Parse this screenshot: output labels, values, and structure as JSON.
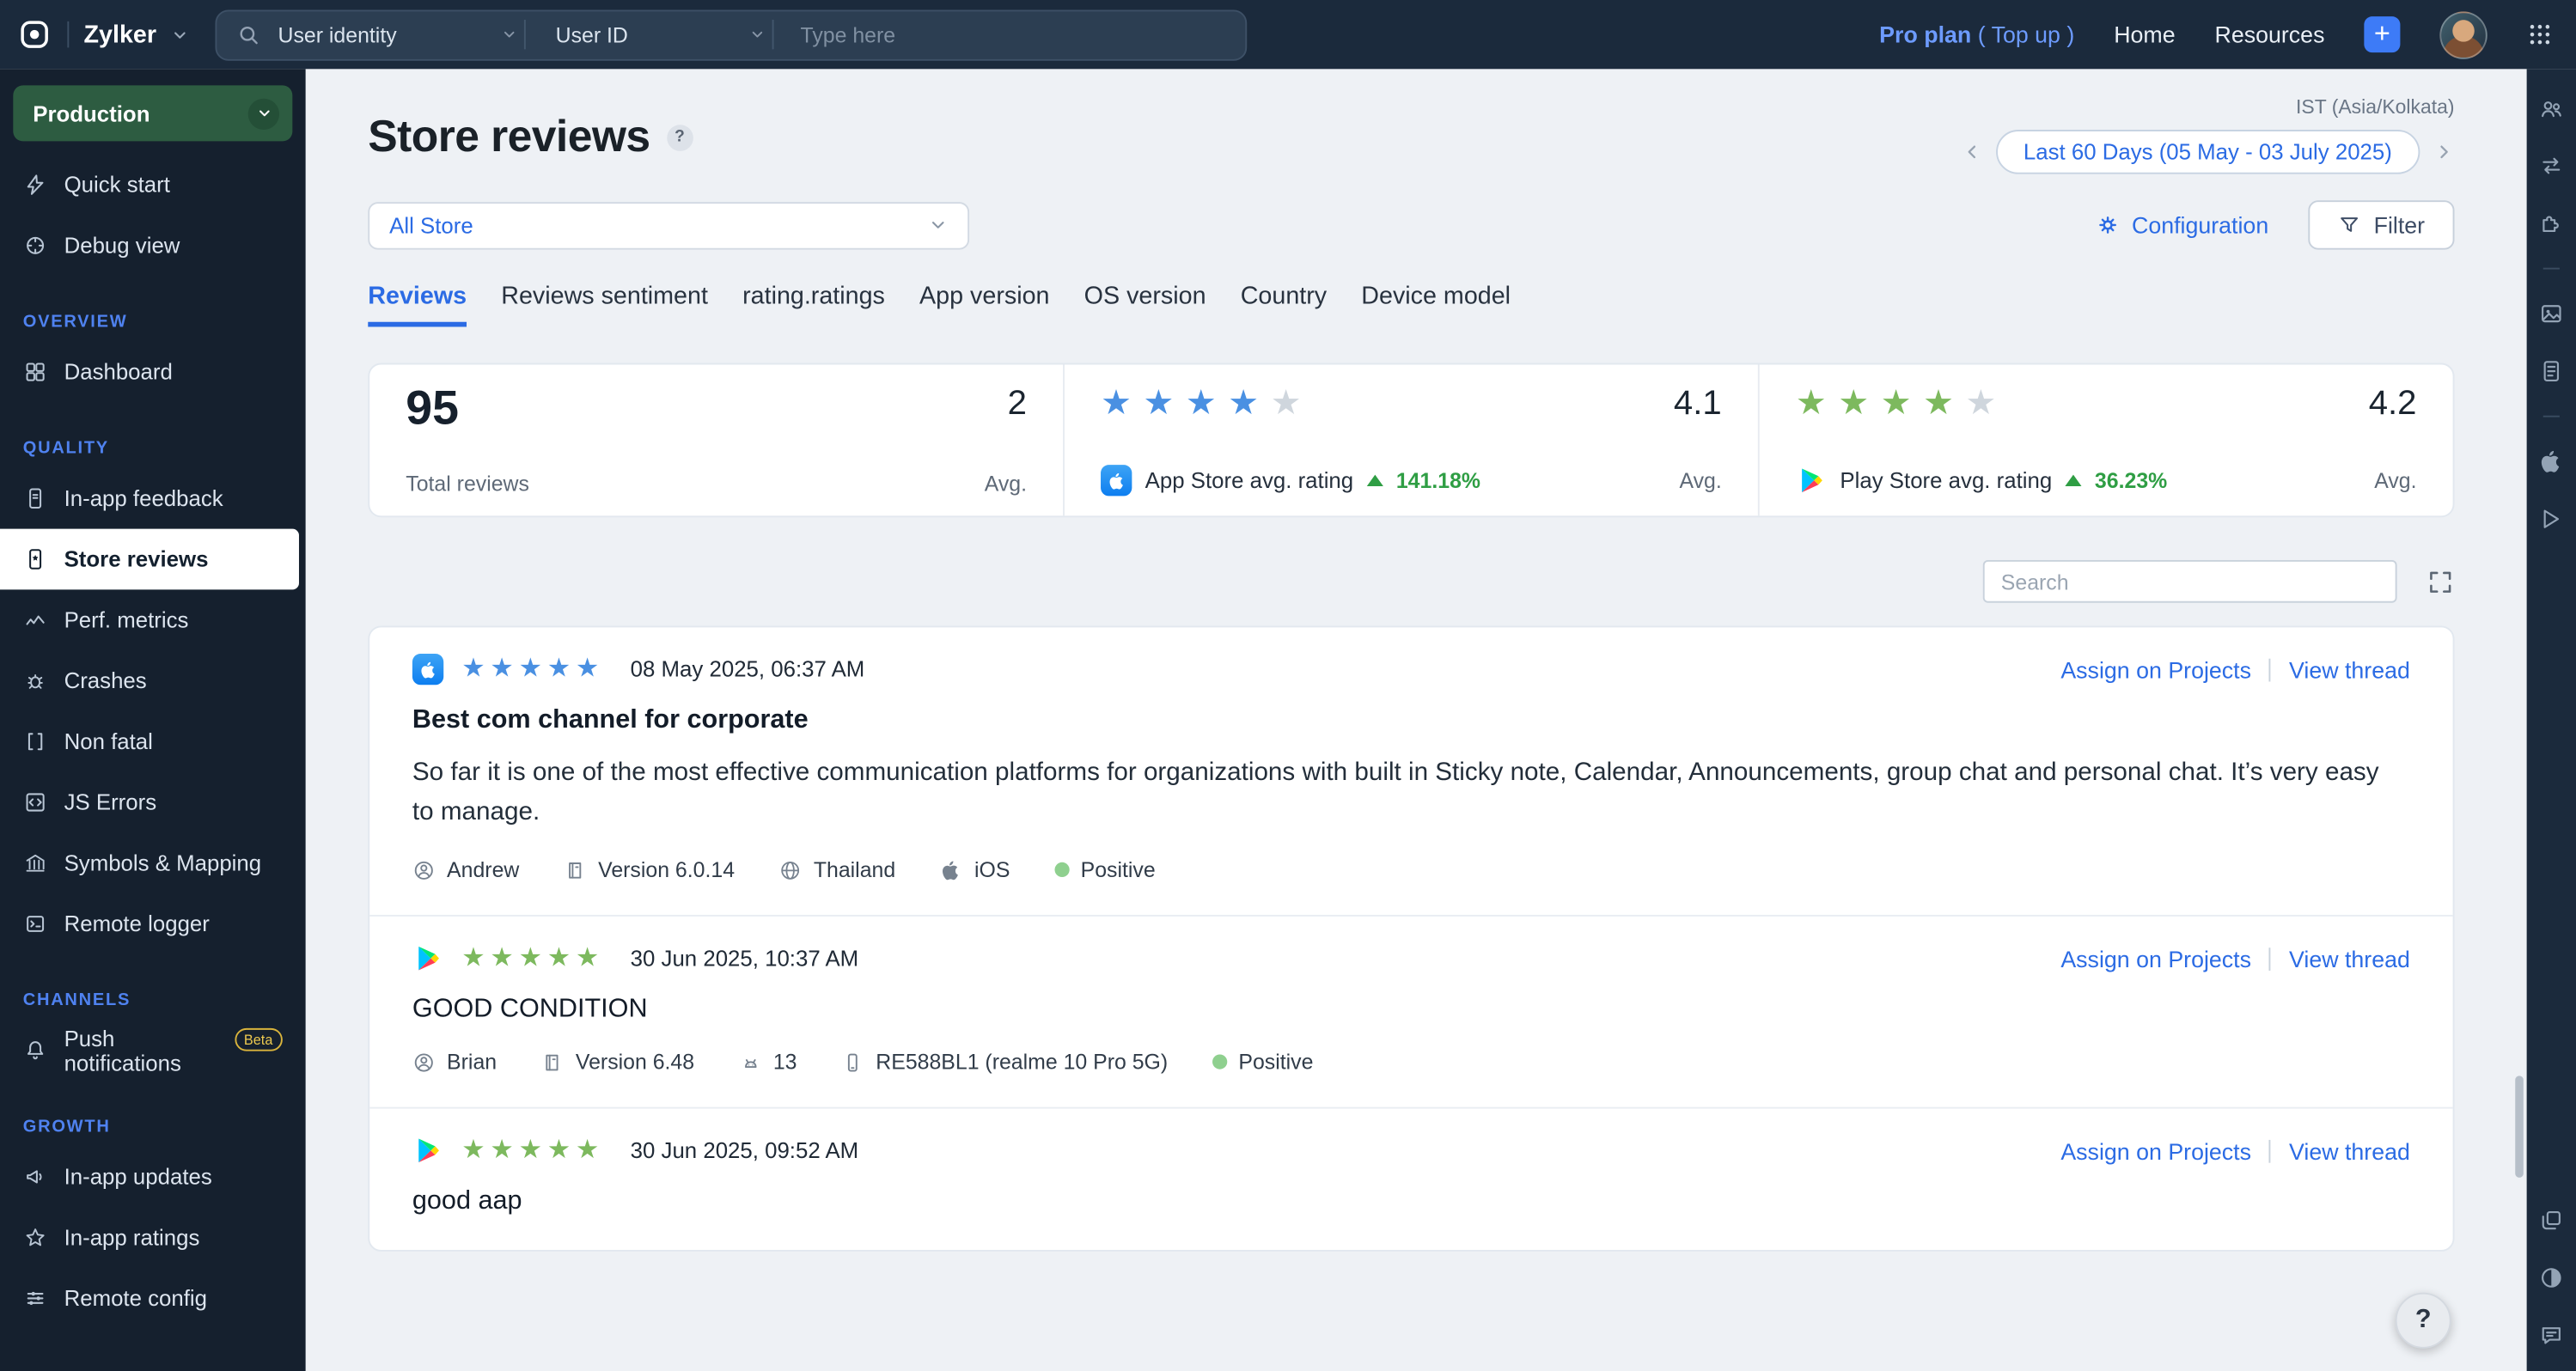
{
  "topbar": {
    "brand": "Zylker",
    "search_scope": "User identity",
    "search_field": "User ID",
    "search_placeholder": "Type here",
    "plan": "Pro plan",
    "topup": "( Top up )",
    "home": "Home",
    "resources": "Resources"
  },
  "sidebar": {
    "environment": "Production",
    "quick_start": "Quick start",
    "debug_view": "Debug view",
    "sections": [
      {
        "title": "OVERVIEW",
        "items": [
          {
            "label": "Dashboard"
          }
        ]
      },
      {
        "title": "QUALITY",
        "items": [
          {
            "label": "In-app feedback"
          },
          {
            "label": "Store reviews"
          },
          {
            "label": "Perf. metrics"
          },
          {
            "label": "Crashes"
          },
          {
            "label": "Non fatal"
          },
          {
            "label": "JS Errors"
          },
          {
            "label": "Symbols & Mapping"
          },
          {
            "label": "Remote logger"
          }
        ]
      },
      {
        "title": "CHANNELS",
        "items": [
          {
            "label": "Push notifications",
            "badge": "Beta"
          }
        ]
      },
      {
        "title": "GROWTH",
        "items": [
          {
            "label": "In-app updates"
          },
          {
            "label": "In-app ratings"
          },
          {
            "label": "Remote config"
          }
        ]
      }
    ]
  },
  "page": {
    "title": "Store reviews",
    "help": "?",
    "timezone": "IST (Asia/Kolkata)",
    "date_range": "Last 60 Days (05 May - 03 July 2025)",
    "store_filter": "All Store",
    "configuration": "Configuration",
    "filter": "Filter",
    "search_placeholder": "Search",
    "help_button": "?"
  },
  "tabs": {
    "active": "Reviews",
    "items": [
      "Reviews",
      "Reviews sentiment",
      "rating.ratings",
      "App version",
      "OS version",
      "Country",
      "Device model"
    ]
  },
  "stats": {
    "total_reviews": {
      "value": "95",
      "label": "Total reviews",
      "avg": "2",
      "avg_label": "Avg."
    },
    "app_store": {
      "stars": 4,
      "label": "App Store avg. rating",
      "change": "141.18%",
      "avg": "4.1",
      "avg_label": "Avg."
    },
    "play_store": {
      "stars": 4,
      "label": "Play Store avg. rating",
      "change": "36.23%",
      "avg": "4.2",
      "avg_label": "Avg."
    }
  },
  "reviews": [
    {
      "store": "App Store",
      "stars": 5,
      "date": "08 May 2025, 06:37 AM",
      "assign_link": "Assign on Projects",
      "view_link": "View thread",
      "title": "Best com channel for corporate",
      "body": "So far it is one of the most effective communication platforms for organizations with built in Sticky note, Calendar, Announcements, group chat and personal chat. It’s very easy to manage.",
      "author": "Andrew",
      "version": "Version 6.0.14",
      "country": "Thailand",
      "os": "iOS",
      "sentiment": "Positive"
    },
    {
      "store": "Play Store",
      "stars": 5,
      "date": "30 Jun 2025, 10:37 AM",
      "assign_link": "Assign on Projects",
      "view_link": "View thread",
      "title": "GOOD CONDITION",
      "author": "Brian",
      "version": "Version 6.48",
      "os_version": "13",
      "device": "RE588BL1 (realme 10 Pro 5G)",
      "sentiment": "Positive"
    },
    {
      "store": "Play Store",
      "stars": 5,
      "date": "30 Jun 2025, 09:52 AM",
      "assign_link": "Assign on Projects",
      "view_link": "View thread",
      "title": "good aap"
    }
  ],
  "colors": {
    "accent_blue": "#2b6be4",
    "star_blue": "#4a90e2",
    "star_green": "#7db95e",
    "positive_green": "#8fd08f",
    "change_green": "#2f9e44",
    "environment_green": "#2d5c41",
    "topbar_bg": "#1b2a3c",
    "sidebar_bg": "#15202e"
  }
}
